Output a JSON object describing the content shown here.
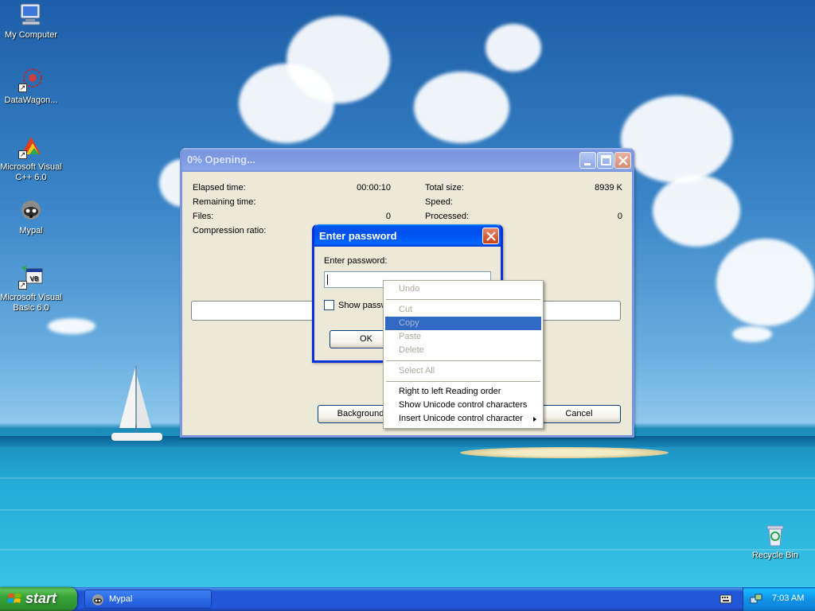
{
  "desktop": {
    "icons": [
      {
        "label": "My Computer",
        "icon": "my-computer-icon"
      },
      {
        "label": "DataWagon...",
        "icon": "datawagon-icon"
      },
      {
        "label": "Microsoft Visual C++ 6.0",
        "icon": "visual-cpp-icon"
      },
      {
        "label": "Mypal",
        "icon": "mypal-raccoon-icon"
      },
      {
        "label": "Microsoft Visual Basic 6.0",
        "icon": "visual-basic-icon"
      },
      {
        "label": "Recycle Bin",
        "icon": "recycle-bin-icon"
      }
    ]
  },
  "progress_window": {
    "title": "0% Opening...",
    "elapsed_label": "Elapsed time:",
    "elapsed_value": "00:00:10",
    "remaining_label": "Remaining time:",
    "files_label": "Files:",
    "files_value": "0",
    "compression_label": "Compression ratio:",
    "total_size_label": "Total size:",
    "total_size_value": "8939 K",
    "speed_label": "Speed:",
    "processed_label": "Processed:",
    "processed_value": "0",
    "progress_percent": 0,
    "background_button": "Background",
    "cancel_button": "Cancel"
  },
  "password_dialog": {
    "title": "Enter password",
    "field_label": "Enter password:",
    "field_value": "",
    "show_password_label": "Show password",
    "show_password_checked": false,
    "ok_button": "OK"
  },
  "context_menu": {
    "items": [
      {
        "label": "Undo",
        "enabled": false
      },
      {
        "separator": true
      },
      {
        "label": "Cut",
        "enabled": false
      },
      {
        "label": "Copy",
        "enabled": false,
        "highlighted": true
      },
      {
        "label": "Paste",
        "enabled": false
      },
      {
        "label": "Delete",
        "enabled": false
      },
      {
        "separator": true
      },
      {
        "label": "Select All",
        "enabled": false
      },
      {
        "separator": true
      },
      {
        "label": "Right to left Reading order",
        "enabled": true
      },
      {
        "label": "Show Unicode control characters",
        "enabled": true
      },
      {
        "label": "Insert Unicode control character",
        "enabled": true,
        "submenu": true
      }
    ]
  },
  "taskbar": {
    "start_label": "start",
    "tasks": [
      {
        "label": "Mypal",
        "icon": "mypal-raccoon-icon"
      }
    ],
    "clock": "7:03 AM",
    "tray_icons": [
      "keyboard-icon",
      "network-icon"
    ]
  },
  "colors": {
    "title_active": "#0054e3",
    "title_inactive": "#7a96df",
    "menu_highlight": "#316ac5",
    "window_face": "#ece9d8"
  }
}
